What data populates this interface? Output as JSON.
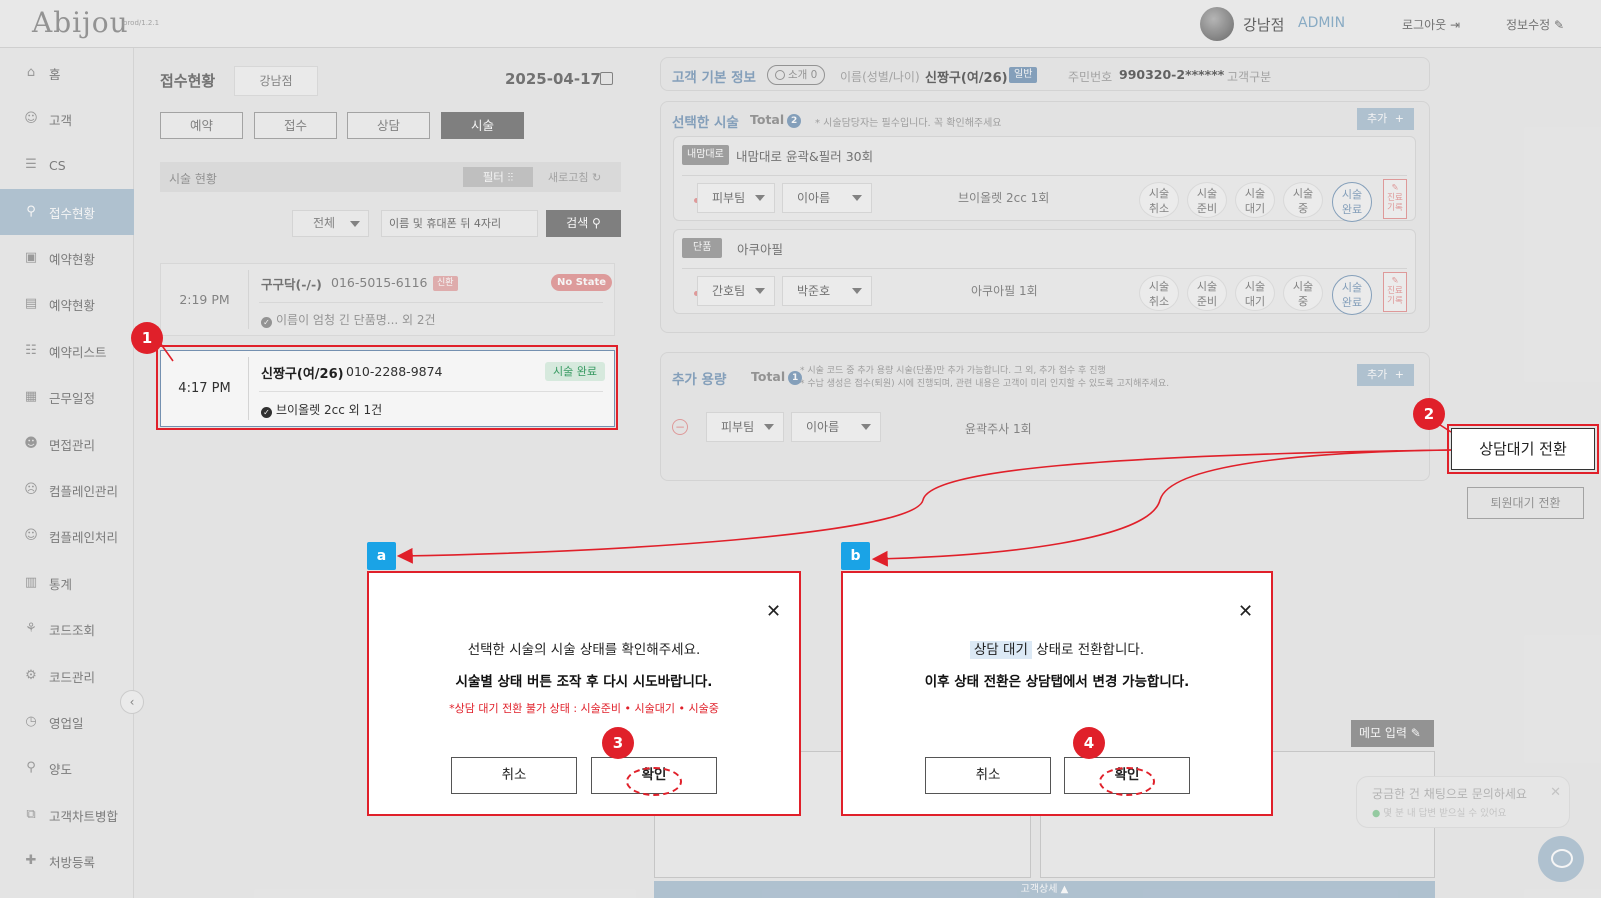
{
  "header": {
    "logo": "Abijou",
    "version": "prod/1.2.1",
    "user_name": "강남점",
    "user_role": "ADMIN",
    "logout": "로그아웃 ⇥",
    "profile_edit": "정보수정 ✎"
  },
  "sidebar": {
    "items": [
      {
        "label": "홈",
        "icon": "⌂"
      },
      {
        "label": "고객",
        "icon": "☺"
      },
      {
        "label": "CS",
        "icon": "☰"
      },
      {
        "label": "접수현황",
        "icon": "⚲"
      },
      {
        "label": "예약현황",
        "icon": "▣"
      },
      {
        "label": "예약현황",
        "icon": "▤"
      },
      {
        "label": "예약리스트",
        "icon": "☷"
      },
      {
        "label": "근무일정",
        "icon": "▦"
      },
      {
        "label": "면접관리",
        "icon": "☻"
      },
      {
        "label": "컴플레인관리",
        "icon": "☹"
      },
      {
        "label": "컴플레인처리",
        "icon": "☺"
      },
      {
        "label": "통계",
        "icon": "▥"
      },
      {
        "label": "코드조회",
        "icon": "⚘"
      },
      {
        "label": "코드관리",
        "icon": "⚙"
      },
      {
        "label": "영업일",
        "icon": "◷"
      },
      {
        "label": "양도",
        "icon": "⚲"
      },
      {
        "label": "고객차트병합",
        "icon": "⧉"
      },
      {
        "label": "처방등록",
        "icon": "✚"
      }
    ],
    "active_index": 3,
    "collapse": "‹"
  },
  "reception": {
    "title": "접수현황",
    "branch": "강남점",
    "date": "2025-04-17",
    "tabs": [
      "예약",
      "접수",
      "상담",
      "시술"
    ],
    "active_tab": 3,
    "status_label": "시술 현황",
    "filter": "필터 ⫶⫶",
    "refresh": "새로고침 ↻",
    "select_all": "전체",
    "search_placeholder": "이름 및 휴대폰 뒤 4자리",
    "search_btn": "검색 ⚲",
    "cards": [
      {
        "time": "2:19 PM",
        "name": "구구닥(-/-)",
        "phone": "016-5015-6116",
        "tag": "신환",
        "state": "No State",
        "sub": "이름이 엄청 긴 단품명... 외 2건"
      },
      {
        "time": "4:17 PM",
        "name": "신짱구(여/26)",
        "phone": "010-2288-9874",
        "state": "시술 완료",
        "sub": "브이올렛 2cc 외 1건"
      }
    ]
  },
  "customer": {
    "section_title": "고객 기본 정보",
    "intro_chip": "소개 0",
    "name_label": "이름(성별/나이)",
    "name_value": "신짱구(여/26)",
    "grade_badge": "일반",
    "rrn_label": "주민번호",
    "rrn_value": "990320-2******",
    "type_label": "고객구분"
  },
  "procedures": {
    "title": "선택한 시술",
    "total_label": "Total",
    "total": "2",
    "note": "* 시술담당자는 필수입니다. 꼭 확인해주세요",
    "add": "추가",
    "plus": "+",
    "items": [
      {
        "tag": "내맘대로",
        "name": "내맘대로 윤곽&필러 30회",
        "team": "피부팀",
        "staff": "이아름",
        "desc": "브이올렛 2cc 1회"
      },
      {
        "tag": "단품",
        "name": "아쿠아필",
        "team": "간호팀",
        "staff": "박준호",
        "desc": "아쿠아필 1회"
      }
    ],
    "status_buttons": [
      {
        "line1": "시술",
        "line2": "취소"
      },
      {
        "line1": "시술",
        "line2": "준비"
      },
      {
        "line1": "시술",
        "line2": "대기"
      },
      {
        "line1": "시술",
        "line2": "중"
      }
    ],
    "done_button": {
      "line1": "시술",
      "line2": "완료"
    },
    "memo_button": "✎\n진료\n기록"
  },
  "extra": {
    "title": "추가 용량",
    "total_label": "Total",
    "total": "1",
    "note1": "* 시술 코드 중 추가 용량 시술(단품)만 추가 가능합니다. 그 외, 추가 접수 후 진행",
    "note2": "* 수납 생성은 접수(퇴원) 시에 진행되며, 관련 내용은 고객이 미리 인지할 수 있도록 고지해주세요.",
    "add": "추가",
    "plus": "+",
    "remove": "−",
    "team": "피부팀",
    "staff": "이아름",
    "desc": "윤곽주사 1회"
  },
  "actions": {
    "consult_wait": "상담대기 전환",
    "discharge_wait": "퇴원대기 전환",
    "memo_input": "메모 입력 ✎",
    "customer_detail": "고객상세 ▲"
  },
  "chat": {
    "title": "궁금한 건 채팅으로 문의하세요",
    "sub": "몇 분 내 답변 받으실 수 있어요",
    "close": "✕"
  },
  "callouts": {
    "n1": "1",
    "n2": "2",
    "n3": "3",
    "n4": "4",
    "a": "a",
    "b": "b"
  },
  "dialog_a": {
    "close": "✕",
    "line1": "선택한 시술의 시술 상태를 확인해주세요.",
    "line2": "시술별 상태 버튼 조작 후 다시 시도바랍니다.",
    "line3": "*상담 대기 전환 불가 상태 : 시술준비 • 시술대기 • 시술중",
    "cancel": "취소",
    "confirm": "확인"
  },
  "dialog_b": {
    "close": "✕",
    "chip": "상담 대기",
    "line1_rest": " 상태로 전환합니다.",
    "line2": "이후 상태 전환은 상담탭에서 변경 가능합니다.",
    "cancel": "취소",
    "confirm": "확인"
  },
  "colors": {
    "accent": "#8aa6c2",
    "annotation_red": "#e0202a",
    "annotation_blue": "#1aa3e6",
    "done_green": "#3aa166"
  }
}
